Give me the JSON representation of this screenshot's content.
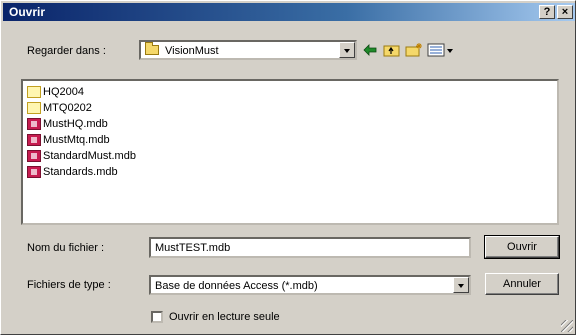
{
  "window": {
    "title": "Ouvrir",
    "help_btn": "?",
    "close_btn": "×"
  },
  "lookin": {
    "label": "Regarder dans :",
    "value": "VisionMust"
  },
  "files": [
    {
      "name": "HQ2004",
      "type": "folder"
    },
    {
      "name": "MTQ0202",
      "type": "folder"
    },
    {
      "name": "MustHQ.mdb",
      "type": "mdb"
    },
    {
      "name": "MustMtq.mdb",
      "type": "mdb"
    },
    {
      "name": "StandardMust.mdb",
      "type": "mdb"
    },
    {
      "name": "Standards.mdb",
      "type": "mdb"
    }
  ],
  "filename": {
    "label": "Nom du fichier :",
    "value": "MustTEST.mdb"
  },
  "filetype": {
    "label": "Fichiers de type :",
    "value": "Base de données Access (*.mdb)"
  },
  "buttons": {
    "open": "Ouvrir",
    "cancel": "Annuler"
  },
  "readonly": {
    "label": "Ouvrir en lecture seule"
  },
  "colors": {
    "title_start": "#0a246a",
    "title_end": "#a6caf0",
    "face": "#d4d0c8"
  }
}
